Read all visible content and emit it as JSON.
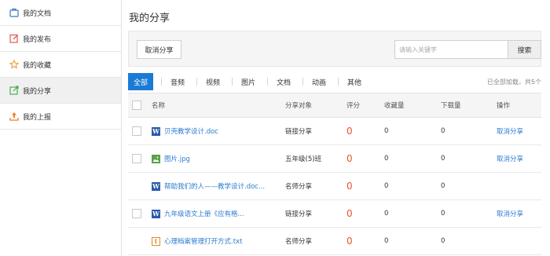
{
  "sidebar": {
    "items": [
      {
        "label": "我的文档",
        "icon": "briefcase-icon",
        "color": "#3a78c9"
      },
      {
        "label": "我的发布",
        "icon": "edit-icon",
        "color": "#e05a4a"
      },
      {
        "label": "我的收藏",
        "icon": "star-icon",
        "color": "#e6a23c"
      },
      {
        "label": "我的分享",
        "icon": "share-icon",
        "color": "#4caf50"
      },
      {
        "label": "我的上报",
        "icon": "upload-icon",
        "color": "#ef7d22"
      }
    ],
    "active_index": 3
  },
  "main": {
    "title": "我的分享",
    "toolbar": {
      "cancel_share_label": "取消分享",
      "search_placeholder": "请输入关键字",
      "search_label": "搜索"
    },
    "filters": {
      "tabs": [
        "全部",
        "音频",
        "视频",
        "图片",
        "文档",
        "动画",
        "其他"
      ],
      "active_index": 0,
      "count_text": "已全部加载，共5个"
    },
    "table": {
      "headers": {
        "name": "名称",
        "target": "分享对象",
        "score": "评分",
        "favorites": "收藏量",
        "downloads": "下载量",
        "action": "操作"
      },
      "rows": [
        {
          "name": "贝壳教学设计.doc",
          "type": "word",
          "target": "链接分享",
          "score": "0",
          "favorites": "0",
          "downloads": "0",
          "action": "取消分享",
          "checkbox": true
        },
        {
          "name": "图片.jpg",
          "type": "img",
          "target": "五年级(5)班",
          "score": "0",
          "favorites": "0",
          "downloads": "0",
          "action": "取消分享",
          "checkbox": true
        },
        {
          "name": "帮助我们的人——教学设计.doc...",
          "type": "word",
          "target": "名师分享",
          "score": "0",
          "favorites": "0",
          "downloads": "0",
          "action": "",
          "checkbox": false
        },
        {
          "name": "九年级语文上册《应有格...",
          "type": "word",
          "target": "链接分享",
          "score": "0",
          "favorites": "0",
          "downloads": "0",
          "action": "取消分享",
          "checkbox": true
        },
        {
          "name": "心理档案管理打开方式.txt",
          "type": "txt",
          "target": "名师分享",
          "score": "0",
          "favorites": "0",
          "downloads": "0",
          "action": "",
          "checkbox": false
        }
      ]
    }
  }
}
